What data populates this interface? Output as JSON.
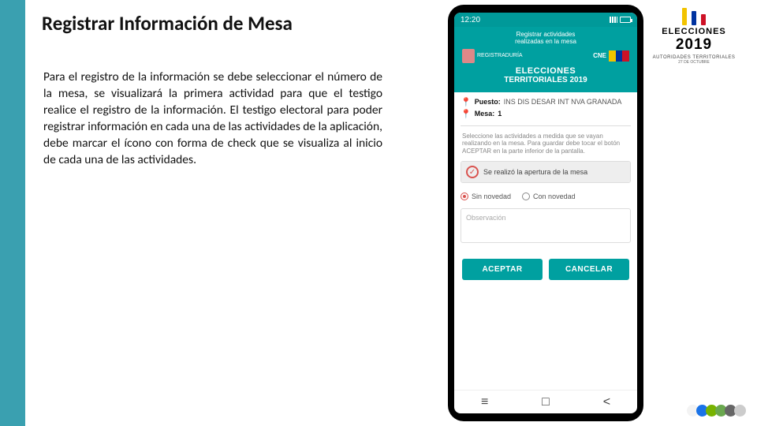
{
  "slide": {
    "title": "Registrar Información de Mesa",
    "body": "Para el registro de la información se debe seleccionar el número de la mesa, se visualizará la primera actividad para que el testigo realice el registro de la información. El testigo electoral para poder registrar información en cada una de las actividades de la aplicación, debe marcar el ícono con forma de check que se visualiza al inicio de cada una de las actividades."
  },
  "logo": {
    "word": "ELECCIONES",
    "year": "2019",
    "sub1": "AUTORIDADES TERRITORIALES",
    "sub2": "27 DE OCTUBRE"
  },
  "phone": {
    "status": {
      "time": "12:20",
      "net": ""
    },
    "header": {
      "line1": "Registrar actividades",
      "line2": "realizadas en la mesa",
      "brand_left": "REGISTRADURÍA",
      "brand_right_label": "CNE",
      "brand_right_sub": "COLOMBIA",
      "title2": "ELECCIONES",
      "title3": "TERRITORIALES 2019"
    },
    "info": {
      "puesto_label": "Puesto:",
      "puesto_value": "INS DIS DESAR INT NVA GRANADA",
      "mesa_label": "Mesa:",
      "mesa_value": "1"
    },
    "instr": "Seleccione las actividades a medida que se vayan realizando en la mesa. Para guardar debe tocar el botón ACEPTAR en la parte inferior de la pantalla.",
    "activity": {
      "label": "Se realizó la apertura de la mesa",
      "opt1": "Sin novedad",
      "opt2": "Con novedad",
      "obs_ph": "Observación"
    },
    "buttons": {
      "accept": "ACEPTAR",
      "cancel": "CANCELAR"
    }
  }
}
